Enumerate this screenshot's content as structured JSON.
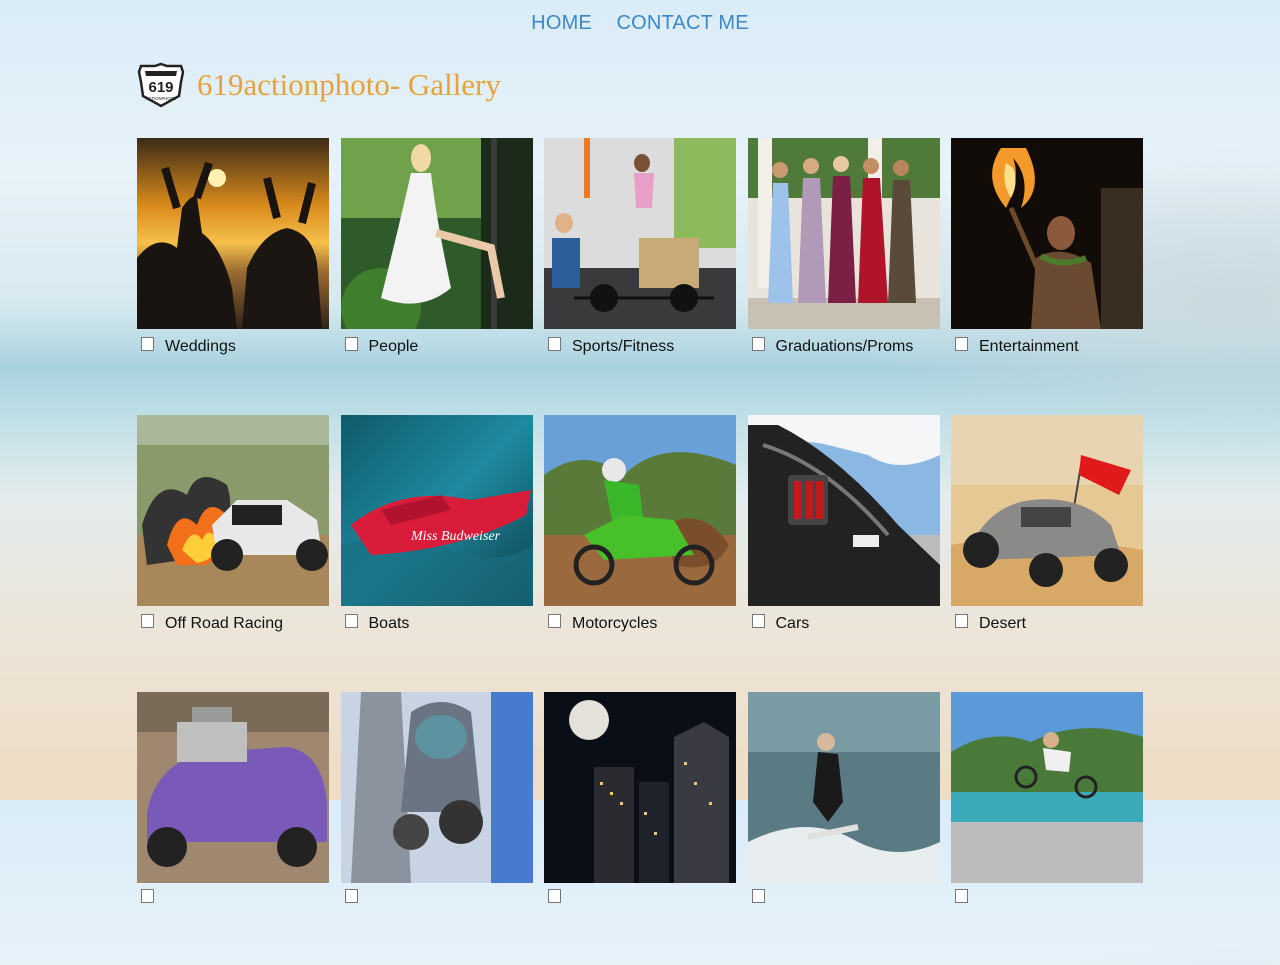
{
  "nav": {
    "home": "HOME",
    "contact": "CONTACT ME"
  },
  "header": {
    "title": "619actionphoto- Gallery",
    "logo_text": "619",
    "logo_sub": "ACTIONPHOTO"
  },
  "gallery": [
    {
      "label": "Weddings"
    },
    {
      "label": "People"
    },
    {
      "label": "Sports/Fitness"
    },
    {
      "label": "Graduations/Proms"
    },
    {
      "label": "Entertainment"
    },
    {
      "label": "Off Road Racing"
    },
    {
      "label": "Boats"
    },
    {
      "label": "Motorcycles"
    },
    {
      "label": "Cars"
    },
    {
      "label": "Desert"
    },
    {
      "label": ""
    },
    {
      "label": ""
    },
    {
      "label": ""
    },
    {
      "label": ""
    },
    {
      "label": ""
    }
  ]
}
